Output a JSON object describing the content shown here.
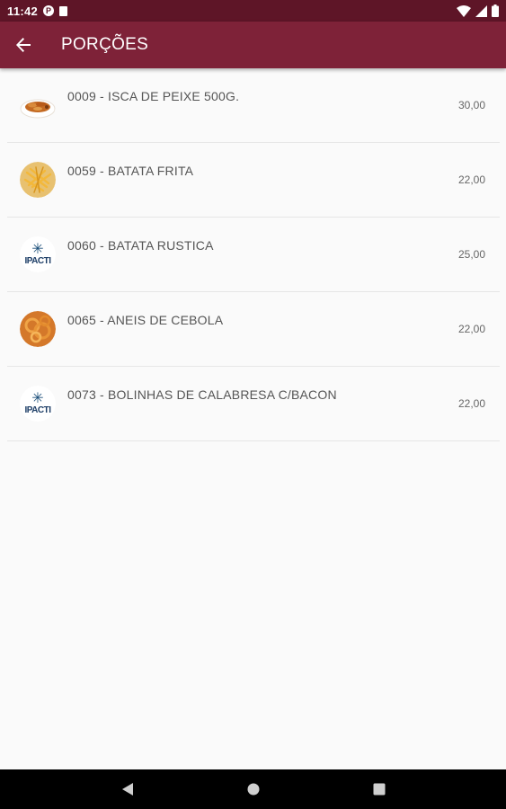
{
  "status_bar": {
    "time": "11:42",
    "notif_icon": "P"
  },
  "app_bar": {
    "title": "PORÇÕES"
  },
  "items": [
    {
      "name": "0009 - ISCA DE PEIXE 500G.",
      "price": "30,00",
      "image": "fish-strips"
    },
    {
      "name": "0059 - BATATA FRITA",
      "price": "22,00",
      "image": "french-fries"
    },
    {
      "name": "0060 - BATATA RUSTICA",
      "price": "25,00",
      "image": "impacto-logo"
    },
    {
      "name": "0065 - ANEIS DE CEBOLA",
      "price": "22,00",
      "image": "onion-rings"
    },
    {
      "name": "0073 - BOLINHAS DE CALABRESA C/BACON",
      "price": "22,00",
      "image": "impacto-logo"
    }
  ],
  "logo_text": "IPACTI",
  "colors": {
    "status_bar": "#5e1527",
    "app_bar": "#7e2238",
    "background": "#fafafa",
    "nav_bar": "#000000"
  }
}
